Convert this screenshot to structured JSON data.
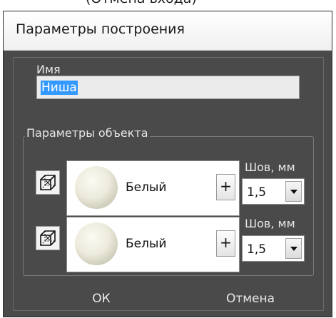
{
  "top_text": "(Отмена входа)",
  "window": {
    "title": "Параметры построения"
  },
  "name_field": {
    "label": "Имя",
    "value": "Ниша"
  },
  "object_group": {
    "legend": "Параметры объекта",
    "rows": [
      {
        "material": "Белый",
        "add_label": "+",
        "seam_label": "Шов, мм",
        "seam_value": "1,5",
        "icon": "wireframe-cube-icon"
      },
      {
        "material": "Белый",
        "add_label": "+",
        "seam_label": "Шов, мм",
        "seam_value": "1,5",
        "icon": "wireframe-cube-icon"
      }
    ]
  },
  "buttons": {
    "ok": "ОК",
    "cancel": "Отмена"
  },
  "colors": {
    "dialog_bg": "#4a4a4a",
    "selection": "#3399ff",
    "text_light": "#e8e8e8"
  }
}
